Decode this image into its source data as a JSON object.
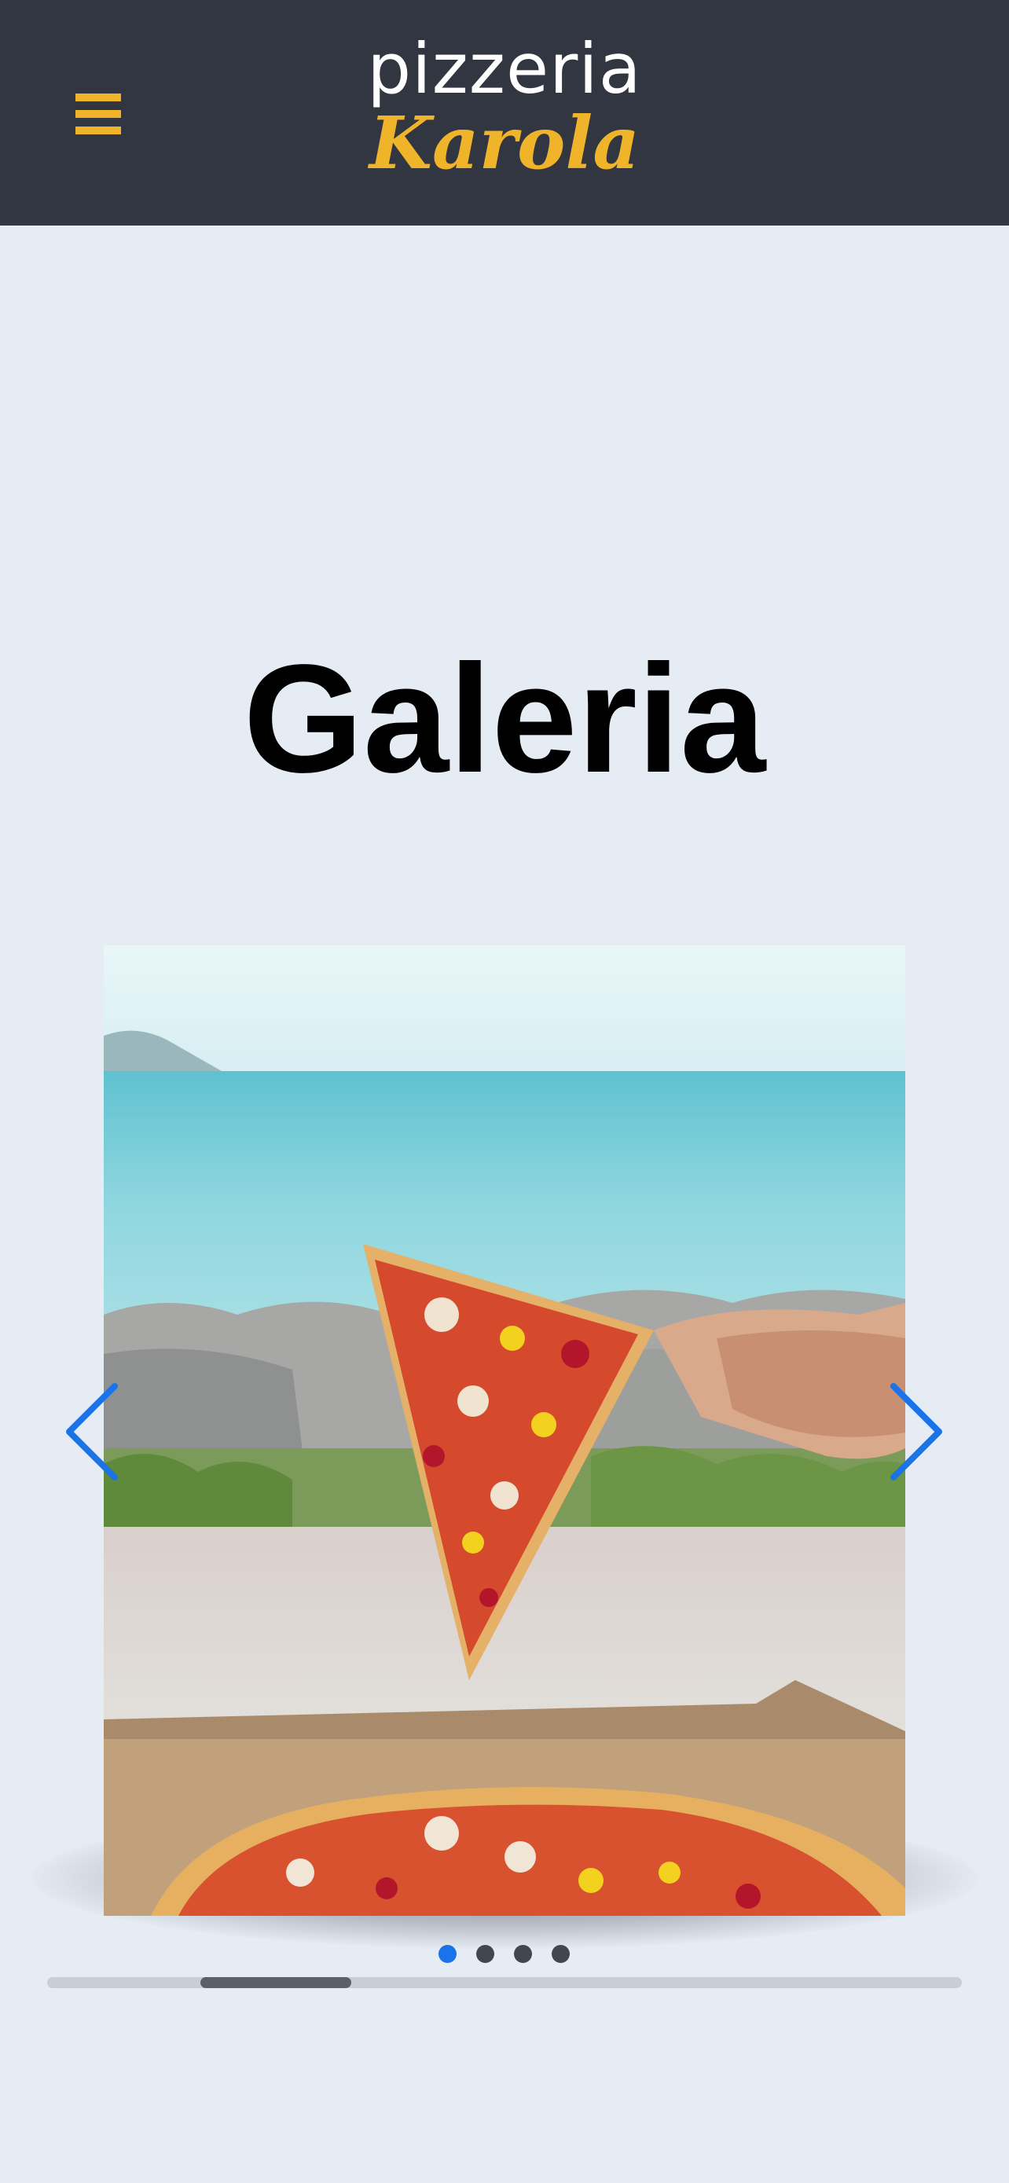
{
  "header": {
    "logo_top": "pizzeria",
    "logo_bottom": "Karola",
    "menu_icon": "hamburger-menu-icon",
    "background_color": "#313641",
    "accent_color": "#f0b42a"
  },
  "main": {
    "title": "Galeria",
    "background_color": "#e6ecf4"
  },
  "gallery": {
    "slide_count": 4,
    "active_slide": 1,
    "image_description_icon": "pizza-photo",
    "prev_icon": "chevron-left-icon",
    "next_icon": "chevron-right-icon",
    "arrow_color": "#1a73e8",
    "scroll_position_fraction": 0.17
  }
}
